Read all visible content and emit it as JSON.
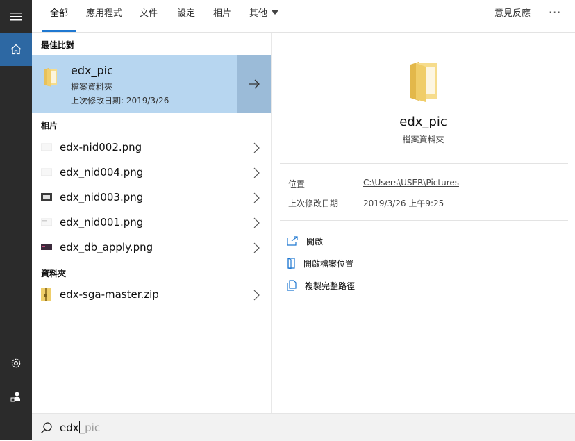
{
  "tabs": [
    {
      "label": "全部",
      "active": true
    },
    {
      "label": "應用程式"
    },
    {
      "label": "文件"
    },
    {
      "label": "設定"
    },
    {
      "label": "相片"
    },
    {
      "label": "其他"
    }
  ],
  "feedback_label": "意見反應",
  "more_label": "···",
  "best_match": {
    "section": "最佳比對",
    "title": "edx_pic",
    "type": "檔案資料夾",
    "modified": "上次修改日期: 2019/3/26"
  },
  "photos": {
    "section": "相片",
    "items": [
      {
        "name": "edx-nid002.png"
      },
      {
        "name": "edx_nid004.png"
      },
      {
        "name": "edx_nid003.png"
      },
      {
        "name": "edx_nid001.png"
      },
      {
        "name": "edx_db_apply.png"
      }
    ]
  },
  "folders": {
    "section": "資料夾",
    "items": [
      {
        "name": "edx-sga-master.zip"
      }
    ]
  },
  "preview": {
    "title": "edx_pic",
    "type": "檔案資料夾",
    "location_label": "位置",
    "location_value": "C:\\Users\\USER\\Pictures",
    "modified_label": "上次修改日期",
    "modified_value": "2019/3/26 上午9:25",
    "actions": [
      {
        "label": "開啟",
        "icon": "open-icon"
      },
      {
        "label": "開啟檔案位置",
        "icon": "file-location-icon"
      },
      {
        "label": "複製完整路徑",
        "icon": "copy-path-icon"
      }
    ]
  },
  "search": {
    "typed": "edx",
    "suggestion": "_pic"
  },
  "colors": {
    "rail": "#2b2b2b",
    "rail_active": "#2d68a3",
    "accent": "#1f78d1",
    "selected": "#b7d6f0"
  }
}
